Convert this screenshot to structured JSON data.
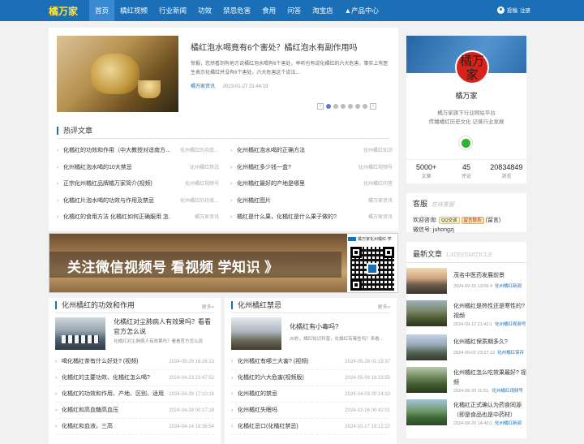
{
  "nav": {
    "logo": "橘万家",
    "items": [
      "首页",
      "橘红视频",
      "行业新闻",
      "功效",
      "禁忌危害",
      "食用",
      "问答",
      "淘宝店",
      "▲产品中心"
    ],
    "login": "投稿",
    "register": "注册"
  },
  "featured": {
    "title": "橘红泡水喝竟有6个害处？橘红泡水有副作用吗",
    "summary": "惊报，您然看到有地方说橘红泡水喝有6个害处，举听也有说化橘红的六大危害，事实上有医生表示化橘红并没有6个害处，六大危害这个说法…",
    "category": "橘万家资讯",
    "date": "2023-01-27 21:44:19"
  },
  "hot": {
    "title": "热评文章",
    "left": [
      {
        "t": "化橘红的功效和作用（中大教授对适南方…",
        "c": "化州橘红的功效…"
      },
      {
        "t": "化州橘红泡水喝的10大禁忌",
        "c": "化州橘红禁忌"
      },
      {
        "t": "正宗化州橘红品牌橘万家简介(视频)",
        "c": "化州橘红视频号"
      },
      {
        "t": "化橘红片泡水喝的功效与作用及禁忌",
        "c": "化州橘红的功效…"
      },
      {
        "t": "化橘红的食用方法 化橘红如何正确服用 怎…",
        "c": "橘万家资讯"
      }
    ],
    "right": [
      {
        "t": "化州橘红泡水喝的正确方法",
        "c": "化州橘红知识"
      },
      {
        "t": "化州橘红多少钱一盒?",
        "c": "化州橘红视频号"
      },
      {
        "t": "化州橘红最好的产地是哪里",
        "c": "化州橘红问答"
      },
      {
        "t": "化州橘红图片",
        "c": "橘万家资讯"
      },
      {
        "t": "橘红是什么果，化橘红是什么果子做的?",
        "c": "橘万家资讯"
      }
    ]
  },
  "profile": {
    "name": "橘万家",
    "avatar_text": "橘万家",
    "desc1": "橘万家旗下行业网站平台",
    "desc2": "传播橘红历史文化 记录行业发展",
    "stats": [
      {
        "n": "5000+",
        "l": "文章"
      },
      {
        "n": "45",
        "l": "评论"
      },
      {
        "n": "20834849",
        "l": "浏览"
      }
    ]
  },
  "kefu": {
    "title": "客服",
    "subtitle": "在线客服",
    "consult": "欢迎咨询:",
    "qq_label": "QQ交谈",
    "qq2_label": "留言联系",
    "msg": "(留言)",
    "wechat": "微信号: juhongzj"
  },
  "ad": {
    "headline": "关注微信视频号 看视频 学知识 》",
    "qr_caption": "橘万家化州橘红·学"
  },
  "col_left": {
    "title": "化州橘红的功效和作用",
    "more": "更多»",
    "top_title": "化橘红对尘肺病人有效果吗？看看官方怎么说",
    "top_desc": "化橘红对尘肺病人有效果吗？看看官方怎么说",
    "items": [
      {
        "t": "喝化橘红茶有什么好处? (视频)",
        "d": "2024-05-29 16:26:13"
      },
      {
        "t": "化橘红的主要功效、化橘红怎么喝?",
        "d": "2024-04-23 23:47:52"
      },
      {
        "t": "化橘红的功效和作用、产地、区别、适用人…",
        "d": "2024-04-28 17:10:16"
      },
      {
        "t": "化橘红和高血糖高血压",
        "d": "2024-04-28 00:17:18"
      },
      {
        "t": "化橘红和血液，三高",
        "d": "2024-04-14 18:36:54"
      }
    ]
  },
  "col_right": {
    "title": "化州橘红禁忌",
    "more": "更多»",
    "top_title": "化橘红有小毒吗?",
    "top_desc": "26秒，橘红知识科普，化橘红有毒性吗？来看…",
    "items": [
      {
        "t": "化州橘红有哪三大害? (视频)",
        "d": "2024-05-28 01:19:37"
      },
      {
        "t": "化橘红的六大危害(视频版)",
        "d": "2024-05-09 18:23:55"
      },
      {
        "t": "化州橘红的禁忌",
        "d": "2024-04-03 00:24:10"
      },
      {
        "t": "化州橘红失眠吗",
        "d": "2024-02-16 00:42:01"
      },
      {
        "t": "化橘红忌口(化橘红禁忌)",
        "d": "2024-02-17 18:12:22"
      }
    ]
  },
  "latest": {
    "title": "最新文章",
    "subtitle": "LATESTARTICLE",
    "items": [
      {
        "t": "茂名中医药发展前景",
        "d": "2024-09-15 13:06:4",
        "c": "化州橘红新闻"
      },
      {
        "t": "化州橘红是热性还是寒性的? 视频",
        "d": "2024-09-12 21:42:1",
        "c": "化州橘红视频号"
      },
      {
        "t": "化州橘红保质期多久?",
        "d": "2024-09-02 23:37:12",
        "c": "化州橘红保存"
      },
      {
        "t": "化州橘红怎么吃效果最好? 视频",
        "d": "2024-08-30 11:51:",
        "c": "化州橘红视频号"
      },
      {
        "t": "化橘红正式确认为药食同源（即是食品也是中药材）",
        "d": "2024-08-26 14:40:1",
        "c": "化州橘红新闻"
      }
    ]
  }
}
